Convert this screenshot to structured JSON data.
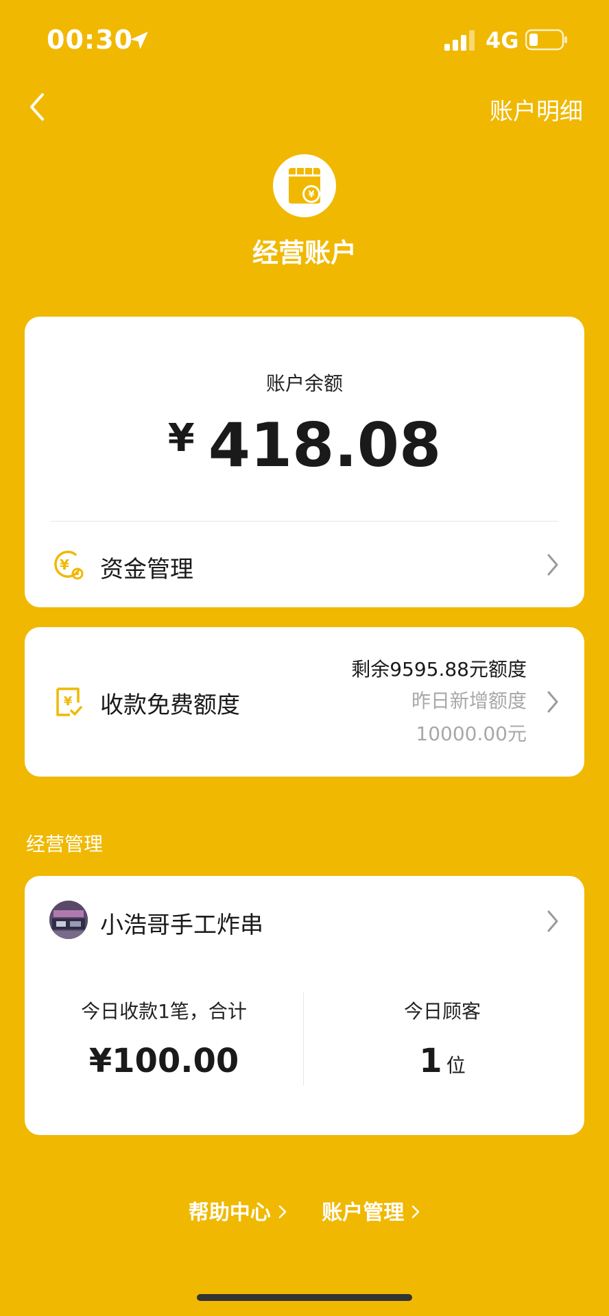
{
  "status_bar": {
    "time": "00:30",
    "network": "4G"
  },
  "nav": {
    "right_label": "账户明细"
  },
  "header": {
    "title": "经营账户"
  },
  "balance_card": {
    "label": "账户余额",
    "currency": "¥",
    "amount": "418.08",
    "fund_row_label": "资金管理"
  },
  "quota_card": {
    "label": "收款免费额度",
    "remaining": "剩余9595.88元额度",
    "yesterday_label": "昨日新增额度",
    "yesterday_value": "10000.00元"
  },
  "section": {
    "title": "经营管理"
  },
  "store_card": {
    "name": "小浩哥手工炸串",
    "today_payments_label": "今日收款1笔，合计",
    "today_payments_value": "¥100.00",
    "today_customers_label": "今日顾客",
    "today_customers_value": "1",
    "today_customers_unit": "位"
  },
  "footer": {
    "help_label": "帮助中心",
    "account_label": "账户管理"
  },
  "colors": {
    "background": "#F0B800",
    "card": "#FFFFFF",
    "accent_icon": "#F0B800",
    "muted_text": "#A8A8A8"
  }
}
